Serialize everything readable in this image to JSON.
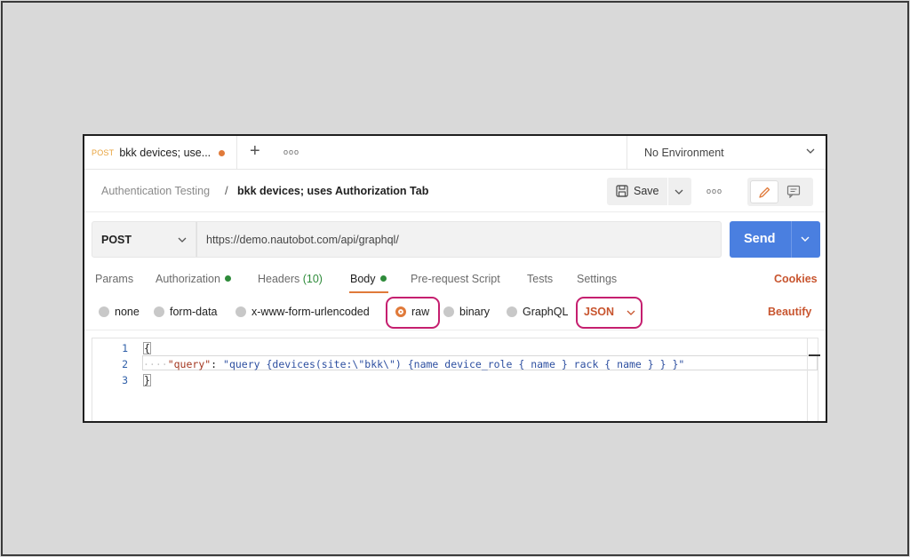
{
  "tabbar": {
    "tab": {
      "method": "POST",
      "title": "bkk devices; use..."
    },
    "add_symbol": "+",
    "more_symbol": "ooo",
    "environment": "No Environment"
  },
  "breadcrumb": {
    "parent": "Authentication Testing",
    "separator": "/",
    "current": "bkk devices; uses Authorization Tab"
  },
  "toolbar": {
    "save_label": "Save",
    "more_symbol": "ooo"
  },
  "request": {
    "method": "POST",
    "url": "https://demo.nautobot.com/api/graphql/",
    "send_label": "Send"
  },
  "request_tabs": {
    "params": "Params",
    "authorization": "Authorization",
    "headers": "Headers",
    "headers_count": "(10)",
    "body": "Body",
    "prerequest": "Pre-request Script",
    "tests": "Tests",
    "settings": "Settings",
    "cookies": "Cookies"
  },
  "body_types": {
    "none": "none",
    "form_data": "form-data",
    "urlencoded": "x-www-form-urlencoded",
    "raw": "raw",
    "binary": "binary",
    "graphql": "GraphQL",
    "selected": "raw",
    "language": "JSON",
    "beautify": "Beautify"
  },
  "editor": {
    "line_numbers": [
      "1",
      "2",
      "3"
    ],
    "line1": "{",
    "line2_indent": "····",
    "line2_key": "\"query\"",
    "line2_colon": ": ",
    "line2_value": "\"query {devices(site:\\\"bkk\\\") {name device_role { name } rack { name } } }\"",
    "line3": "}"
  },
  "colors": {
    "accent": "#e07a3a",
    "send": "#4a7fe0",
    "link_red": "#c8552f",
    "highlight": "#c51f6f",
    "status_green": "#2e8b3a"
  }
}
